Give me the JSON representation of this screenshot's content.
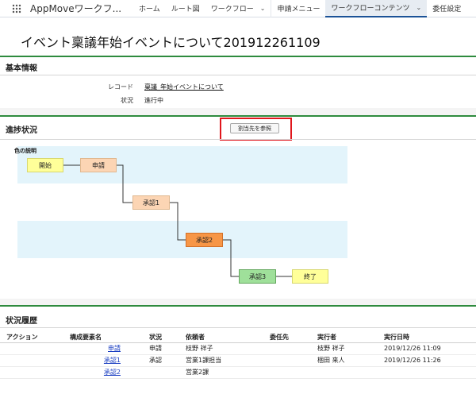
{
  "app": {
    "name": "AppMoveワークフ...",
    "nav": [
      {
        "label": "ホーム",
        "chevron": false,
        "active": false
      },
      {
        "label": "ルート図",
        "chevron": false,
        "active": false
      },
      {
        "label": "ワークフロー",
        "chevron": true,
        "active": false
      },
      {
        "label": "申請メニュー",
        "chevron": false,
        "active": false
      },
      {
        "label": "ワークフローコンテンツ",
        "chevron": true,
        "active": true
      },
      {
        "label": "委任設定",
        "chevron": false,
        "active": false
      }
    ]
  },
  "page": {
    "title": "イベント稟議年始イベントについて201912261109"
  },
  "basic_info": {
    "header": "基本情報",
    "record_label": "レコード",
    "record_value": "稟議_年始イベントについて",
    "status_label": "状況",
    "status_value": "進行中"
  },
  "progress": {
    "header": "進捗状況",
    "ref_button": "割当先を参照",
    "legend_title": "色の説明",
    "nodes": {
      "start": "開始",
      "apply": "申請",
      "approve1": "承認1",
      "approve2": "承認2",
      "approve3": "承認3",
      "end": "終了"
    }
  },
  "history": {
    "header": "状況履歴",
    "columns": [
      "アクション",
      "構成要素名",
      "状況",
      "依頼者",
      "委任先",
      "実行者",
      "実行日時"
    ],
    "rows": [
      {
        "action": "",
        "element": "申請",
        "status": "申請",
        "requester": "枝野 祥子",
        "delegate": "",
        "executor": "枝野 祥子",
        "datetime": "2019/12/26 11:09"
      },
      {
        "action": "",
        "element": "承認1",
        "status": "承認",
        "requester": "営業1課担当",
        "delegate": "",
        "executor": "梱田 来人",
        "datetime": "2019/12/26 11:26"
      },
      {
        "action": "",
        "element": "承認2",
        "status": "",
        "requester": "営業2課",
        "delegate": "",
        "executor": "",
        "datetime": ""
      }
    ]
  }
}
